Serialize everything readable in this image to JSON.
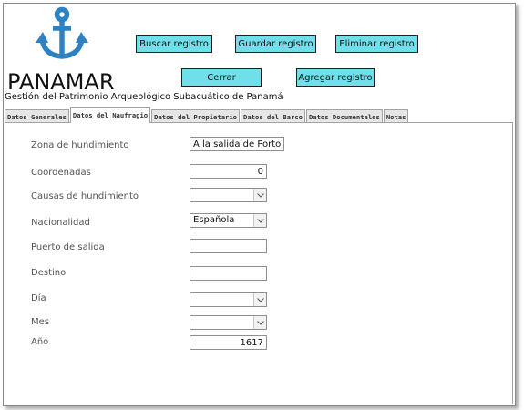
{
  "brand": {
    "name": "PANAMAR",
    "subtitle": "Gestión del Patrimonio Arqueológico Subacuático de Panamá",
    "logo_icon": "anchor-icon",
    "logo_color": "#2f82c1"
  },
  "toolbar": {
    "search_label": "Buscar registro",
    "save_label": "Guardar registro",
    "delete_label": "Eliminar registro",
    "close_label": "Cerrar",
    "add_label": "Agregar  registro",
    "button_color": "#6fe0ea"
  },
  "tabs": [
    {
      "label": "Datos Generales",
      "active": false
    },
    {
      "label": "Datos del Naufragio",
      "active": true
    },
    {
      "label": "Datos del Propietario",
      "active": false
    },
    {
      "label": "Datos del Barco",
      "active": false
    },
    {
      "label": "Datos Documentales",
      "active": false
    },
    {
      "label": "Notas",
      "active": false
    }
  ],
  "form": {
    "zona": {
      "label": "Zona de hundimiento",
      "value": "A la salida de Portobe"
    },
    "coordenadas": {
      "label": "Coordenadas",
      "value": "0"
    },
    "causas": {
      "label": "Causas de hundimiento",
      "value": ""
    },
    "nacionalidad": {
      "label": "Nacionalidad",
      "value": "Española"
    },
    "puerto": {
      "label": "Puerto de salida",
      "value": ""
    },
    "destino": {
      "label": "Destino",
      "value": ""
    },
    "dia": {
      "label": "Día",
      "value": ""
    },
    "mes": {
      "label": "Mes",
      "value": ""
    },
    "anio": {
      "label": "Año",
      "value": "1617"
    }
  }
}
